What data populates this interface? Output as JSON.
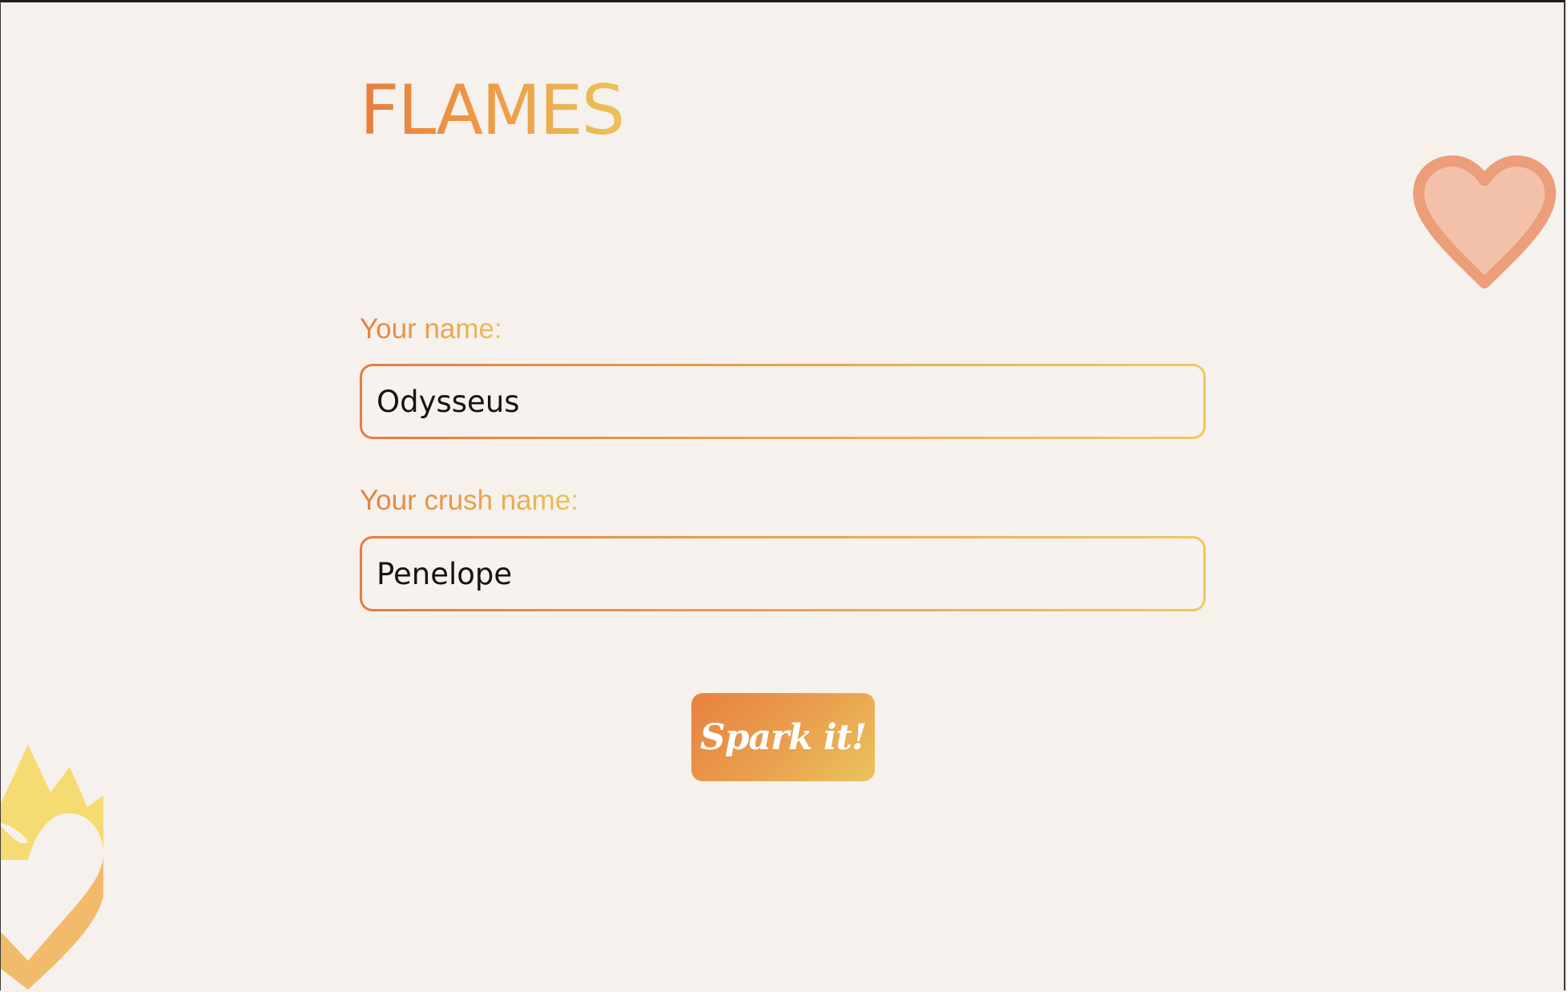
{
  "app": {
    "title": "FLAMES"
  },
  "form": {
    "name_label": "Your name:",
    "name_value": "Odysseus",
    "crush_label": "Your crush name:",
    "crush_value": "Penelope",
    "submit_label": "Spark it!"
  },
  "colors": {
    "background": "#f6f1ec",
    "gradient_start": "#e57d3e",
    "gradient_end": "#e9c45a",
    "heart_fill": "#f3c1aa",
    "heart_stroke": "#ec9d79",
    "flame_yellow": "#f5db72",
    "flame_orange": "#f2bb6b"
  },
  "icons": {
    "decor_right": "heart-icon",
    "decor_left": "flaming-heart-icon"
  }
}
